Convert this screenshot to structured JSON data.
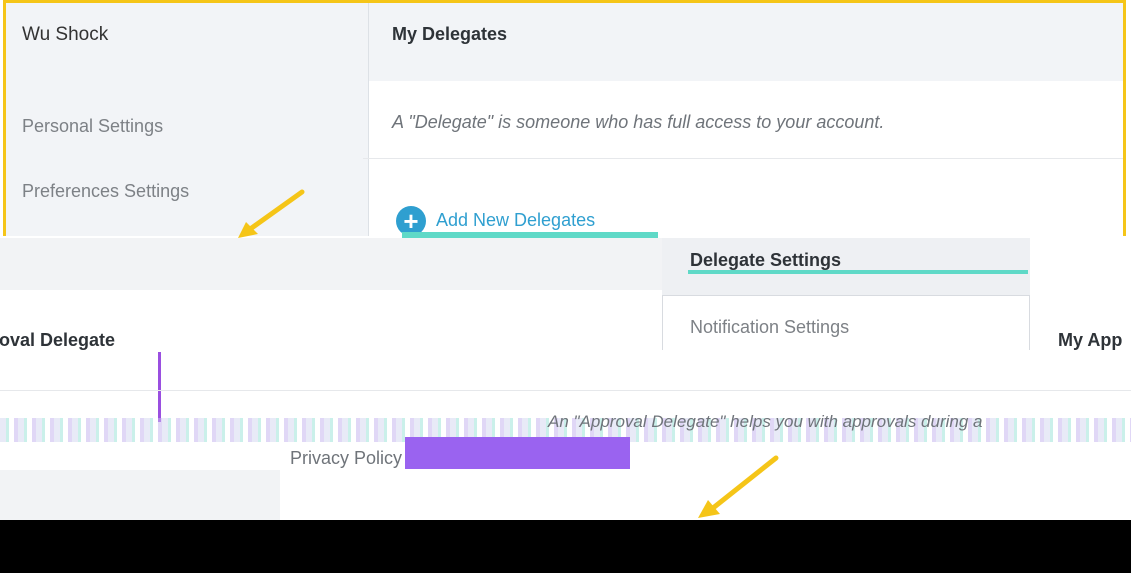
{
  "user": {
    "name": "Wu Shock"
  },
  "sidebar": {
    "items": [
      {
        "label": "Personal Settings"
      },
      {
        "label": "Preferences Settings"
      },
      {
        "label": "Delegate Settings"
      },
      {
        "label": "Notification Settings"
      },
      {
        "label": "Privacy Policy"
      }
    ]
  },
  "main": {
    "title": "My Delegates",
    "description": "A \"Delegate\" is someone who has full access to your account.",
    "add_button_label": "Add New Delegates",
    "approval_title": "roval Delegate",
    "approval_title_right": "My App",
    "approval_description": "An \"Approval Delegate\" helps you with approvals during a"
  },
  "colors": {
    "highlight_frame": "#f5c518",
    "accent": "#2f9fd0",
    "arrow": "#f5c518"
  }
}
